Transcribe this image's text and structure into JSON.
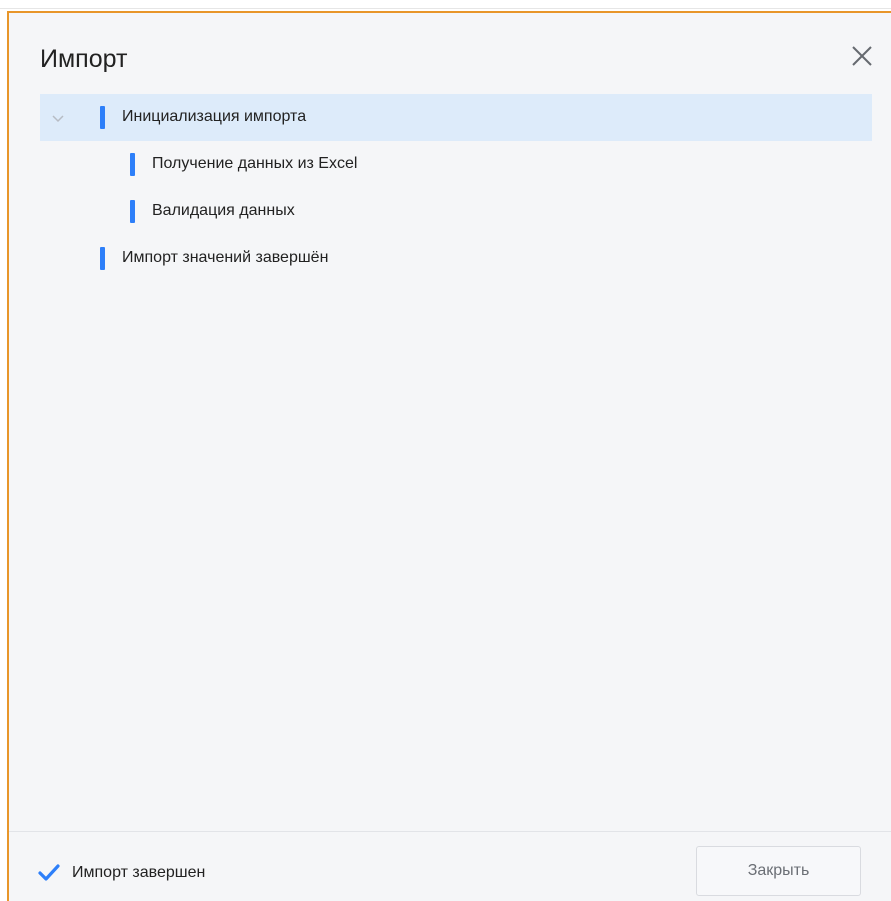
{
  "dialog": {
    "title": "Импорт",
    "close_icon": "close-icon"
  },
  "tree": {
    "items": [
      {
        "label": "Инициализация импорта",
        "level": 0,
        "expanded": true,
        "selected": true
      },
      {
        "label": "Получение данных из Excel",
        "level": 1,
        "selected": false
      },
      {
        "label": "Валидация данных",
        "level": 1,
        "selected": false
      },
      {
        "label": "Импорт значений завершён",
        "level": 0,
        "selected": false
      }
    ]
  },
  "footer": {
    "status_icon": "checkmark-icon",
    "status_text": "Импорт завершен",
    "close_button_label": "Закрыть"
  },
  "colors": {
    "accent": "#2d7ff9",
    "selection": "#ddebfa",
    "border": "#e8962a",
    "background": "#f5f6f8"
  }
}
